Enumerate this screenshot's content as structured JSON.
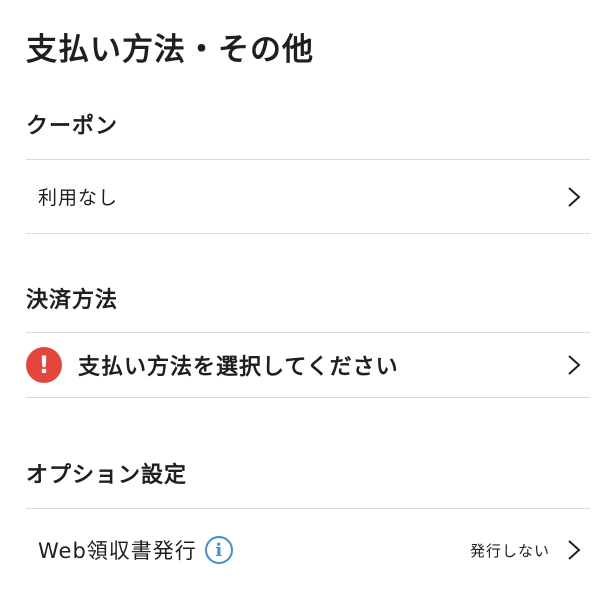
{
  "page": {
    "title": "支払い方法・その他"
  },
  "coupon": {
    "section_title": "クーポン",
    "value": "利用なし"
  },
  "payment": {
    "section_title": "決済方法",
    "prompt": "支払い方法を選択してください",
    "alert_icon": "!"
  },
  "options": {
    "section_title": "オプション設定",
    "receipt_label": "Web領収書発行",
    "info_icon": "i",
    "receipt_value": "発行しない"
  },
  "colors": {
    "alert": "#e4453a",
    "info": "#3f8fd6",
    "divider": "#d8d8d8"
  }
}
